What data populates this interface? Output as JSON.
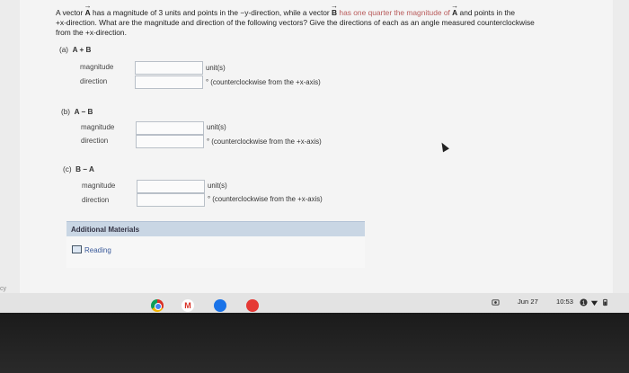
{
  "problem": {
    "line1_a": "A vector ",
    "vecA": "A",
    "line1_b": " has a magnitude of 3 units and points in the −y-direction, while a vector ",
    "vecB": "B",
    "line1_highlight": " has one quarter the magnitude of ",
    "line1_c": " and points in the",
    "line2": "+x-direction. What are the magnitude and direction of the following vectors? Give the directions of each as an angle measured counterclockwise",
    "line3": "from the +x-direction."
  },
  "parts": [
    {
      "label_prefix": "(a)",
      "label_expr": "A + B",
      "magnitude_label": "magnitude",
      "direction_label": "direction",
      "magnitude_unit": "unit(s)",
      "direction_unit": "° (counterclockwise from the +x-axis)",
      "magnitude_value": "",
      "direction_value": ""
    },
    {
      "label_prefix": "(b)",
      "label_expr": "A − B",
      "magnitude_label": "magnitude",
      "direction_label": "direction",
      "magnitude_unit": "unit(s)",
      "direction_unit": "° (counterclockwise from the +x-axis)",
      "magnitude_value": "",
      "direction_value": ""
    },
    {
      "label_prefix": "(c)",
      "label_expr": "B − A",
      "magnitude_label": "magnitude",
      "direction_label": "direction",
      "magnitude_unit": "unit(s)",
      "direction_unit": "° (counterclockwise from the +x-axis)",
      "magnitude_value": "",
      "direction_value": ""
    }
  ],
  "additional": {
    "title": "Additional Materials",
    "reading": "Reading"
  },
  "side_text": "cy",
  "taskbar": {
    "apps": [
      "chrome-icon",
      "gmail-icon",
      "docs-icon",
      "youtube-icon"
    ],
    "gmail_letter": "M",
    "date": "Jun 27",
    "time": "10:53"
  },
  "colors": {
    "highlight": "#b85a5a",
    "panel": "#c9d6e4",
    "link": "#3a5a9a"
  }
}
